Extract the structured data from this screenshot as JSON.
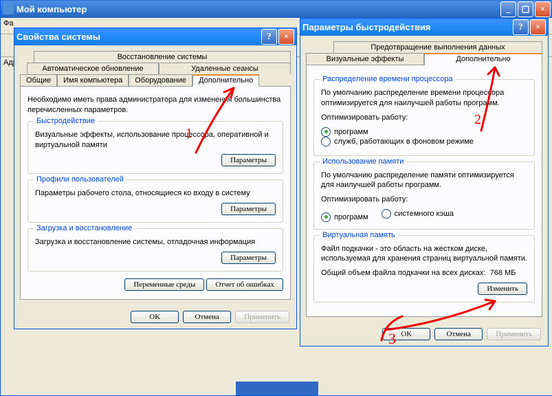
{
  "explorer": {
    "title": "Мой компьютер",
    "menu_file_initial": "Фа",
    "addr_label": "Адр"
  },
  "sysprops": {
    "title": "Свойства системы",
    "tabs": {
      "restore": "Восстановление системы",
      "auto_update": "Автоматическое обновление",
      "remote": "Удаленные сеансы",
      "general": "Общие",
      "computer_name": "Имя компьютера",
      "hardware": "Оборудование",
      "advanced": "Дополнительно"
    },
    "admin_note": "Необходимо иметь права администратора для изменения большинства перечисленных параметров.",
    "perf": {
      "legend": "Быстродействие",
      "desc": "Визуальные эффекты, использование процессора, оперативной и виртуальной памяти",
      "btn": "Параметры"
    },
    "profiles": {
      "legend": "Профили пользователей",
      "desc": "Параметры рабочего стола, относящиеся ко входу в систему",
      "btn": "Параметры"
    },
    "startup": {
      "legend": "Загрузка и восстановление",
      "desc": "Загрузка и восстановление системы, отладочная информация",
      "btn": "Параметры"
    },
    "env_btn": "Переменные среды",
    "err_btn": "Отчет об ошибках",
    "ok": "OK",
    "cancel": "Отмена",
    "apply": "Применить"
  },
  "perfopts": {
    "title": "Параметры быстродействия",
    "tabs": {
      "dep": "Предотвращение выполнения данных",
      "visual": "Визуальные эффекты",
      "advanced": "Дополнительно"
    },
    "cpu": {
      "legend": "Распределение времени процессора",
      "desc": "По умолчанию распределение времени процессора оптимизируется для наилучшей работы программ.",
      "opt_label": "Оптимизировать работу:",
      "r1": "программ",
      "r2": "служб, работающих в фоновом режиме"
    },
    "mem": {
      "legend": "Использование памяти",
      "desc": "По умолчанию распределение памяти оптимизируется для наилучшей работы программ.",
      "opt_label": "Оптимизировать работу:",
      "r1": "программ",
      "r2": "системного кэша"
    },
    "vmem": {
      "legend": "Виртуальная память",
      "desc": "Файл подкачки - это область на жестком диске, используемая для хранения страниц виртуальной памяти.",
      "total_label": "Общий объем файла подкачки на всех дисках:",
      "total_value": "768 МБ",
      "btn": "Изменить"
    },
    "ok": "OK",
    "cancel": "Отмена",
    "apply": "Применить"
  }
}
